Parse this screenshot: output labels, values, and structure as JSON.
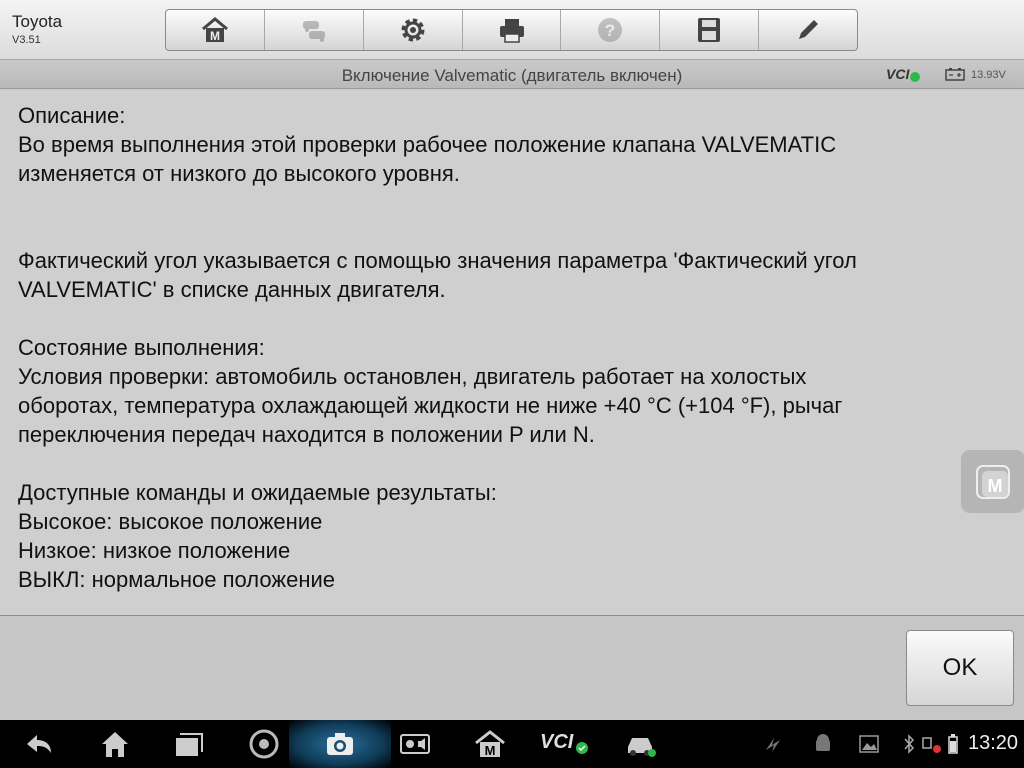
{
  "app": {
    "name": "Toyota",
    "version": "V3.51"
  },
  "toolbar": {
    "buttons": [
      {
        "icon": "home-m-icon",
        "enabled": true
      },
      {
        "icon": "vehicle-swap-icon",
        "enabled": false
      },
      {
        "icon": "gear-icon",
        "enabled": true
      },
      {
        "icon": "printer-icon",
        "enabled": true
      },
      {
        "icon": "help-icon",
        "enabled": false
      },
      {
        "icon": "save-icon",
        "enabled": true
      },
      {
        "icon": "pencil-icon",
        "enabled": true
      }
    ]
  },
  "titlebar": {
    "title": "Включение Valvematic (двигатель включен)",
    "vci_label": "VCI",
    "battery_voltage": "13.93V"
  },
  "content": {
    "text": "Описание:\nВо время выполнения этой проверки рабочее положение клапана VALVEMATIC\nизменяется от низкого до высокого уровня.\n\n\nФактический угол указывается с помощью значения параметра 'Фактический угол\nVALVEMATIC' в списке данных двигателя.\n\nСостояние выполнения:\nУсловия проверки: автомобиль остановлен, двигатель работает на холостых\nоборотах, температура охлаждающей жидкости не ниже +40 °C (+104 °F), рычаг\nпереключения передач находится в положении P или N.\n\nДоступные команды и ожидаемые результаты:\nВысокое: высокое положение\nНизкое: низкое положение\nВЫКЛ: нормальное положение"
  },
  "footer": {
    "ok_label": "OK"
  },
  "navbar": {
    "vci_label": "VCI",
    "clock": "13:20"
  },
  "colors": {
    "status_ok": "#2db84b",
    "background": "#cfcfcf",
    "navbar": "#000000"
  }
}
